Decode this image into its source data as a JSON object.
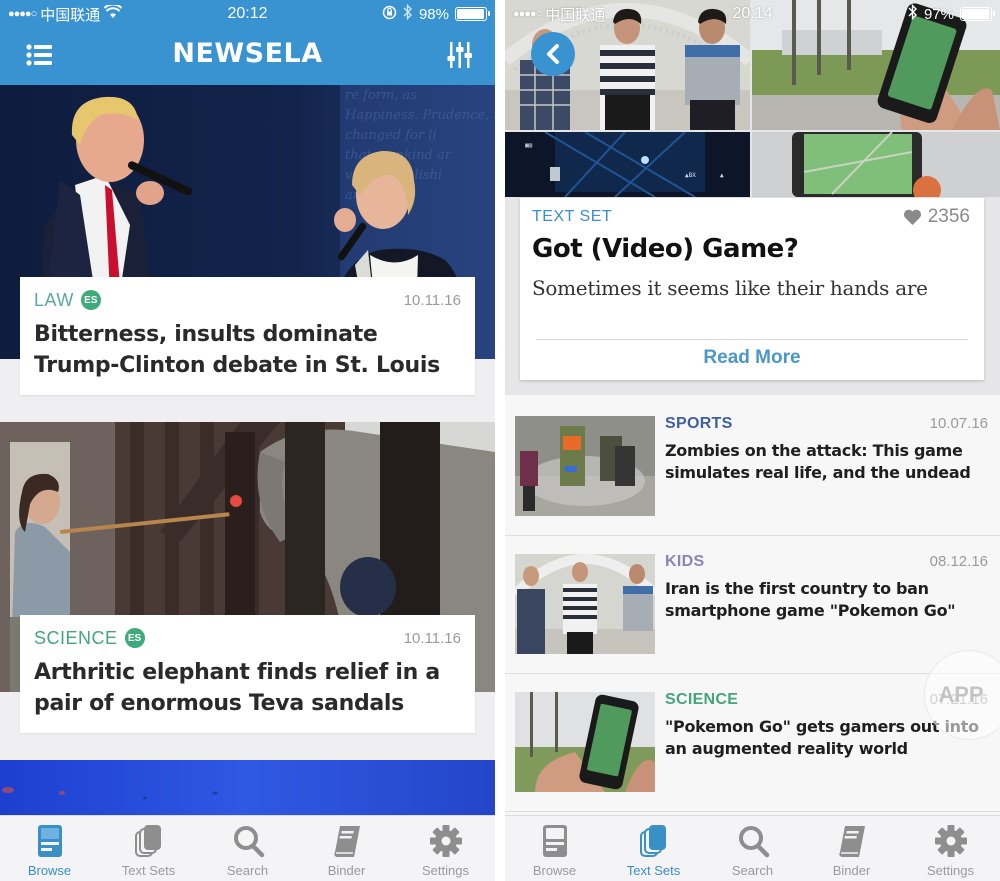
{
  "left": {
    "status": {
      "signal": "●●●●○",
      "carrier": "中国联通",
      "time": "20:12",
      "battery": "98%",
      "battery_level": 0.98
    },
    "navbar": {
      "title": "NEWSELA",
      "menu_icon": "list-icon",
      "filter_icon": "sliders-icon"
    },
    "articles": [
      {
        "category": "LAW",
        "category_color": "#5aa9a0",
        "badge": "ES",
        "date": "10.11.16",
        "title": "Bitterness, insults dominate Trump-Clinton debate in St. Louis"
      },
      {
        "category": "SCIENCE",
        "category_color": "#45a57c",
        "badge": "ES",
        "date": "10.11.16",
        "title": "Arthritic elephant finds relief in a pair of enormous Teva sandals"
      }
    ],
    "tabs": [
      {
        "label": "Browse",
        "icon": "browse-icon",
        "active": true
      },
      {
        "label": "Text Sets",
        "icon": "text-sets-icon",
        "active": false
      },
      {
        "label": "Search",
        "icon": "search-icon",
        "active": false
      },
      {
        "label": "Binder",
        "icon": "binder-icon",
        "active": false
      },
      {
        "label": "Settings",
        "icon": "gear-icon",
        "active": false
      }
    ]
  },
  "right": {
    "status": {
      "signal": "●●●●○",
      "carrier": "中国联通",
      "time": "20:14",
      "battery": "97%",
      "battery_level": 0.97
    },
    "text_set": {
      "label": "TEXT SET",
      "likes": "2356",
      "title": "Got (Video) Game?",
      "description": "Sometimes it seems like their hands are",
      "read_more": "Read More"
    },
    "articles": [
      {
        "category": "SPORTS",
        "category_color": "#3f5f9e",
        "date": "10.07.16",
        "title": "Zombies on the attack: This game simulates real life, and the undead"
      },
      {
        "category": "KIDS",
        "category_color": "#8b84b8",
        "date": "08.12.16",
        "title": "Iran is the first country to ban smartphone game \"Pokemon Go\""
      },
      {
        "category": "SCIENCE",
        "category_color": "#45a57c",
        "date": "07.21.16",
        "title": "\"Pokemon Go\" gets gamers out into an augmented reality world"
      }
    ],
    "tabs": [
      {
        "label": "Browse",
        "icon": "browse-icon",
        "active": false
      },
      {
        "label": "Text Sets",
        "icon": "text-sets-icon",
        "active": true
      },
      {
        "label": "Search",
        "icon": "search-icon",
        "active": false
      },
      {
        "label": "Binder",
        "icon": "binder-icon",
        "active": false
      },
      {
        "label": "Settings",
        "icon": "gear-icon",
        "active": false
      }
    ],
    "watermark": "APP"
  },
  "colors": {
    "brand_blue": "#3893d0",
    "active_tab": "#3a8fc7",
    "inactive_tab": "#8e8e8e"
  }
}
